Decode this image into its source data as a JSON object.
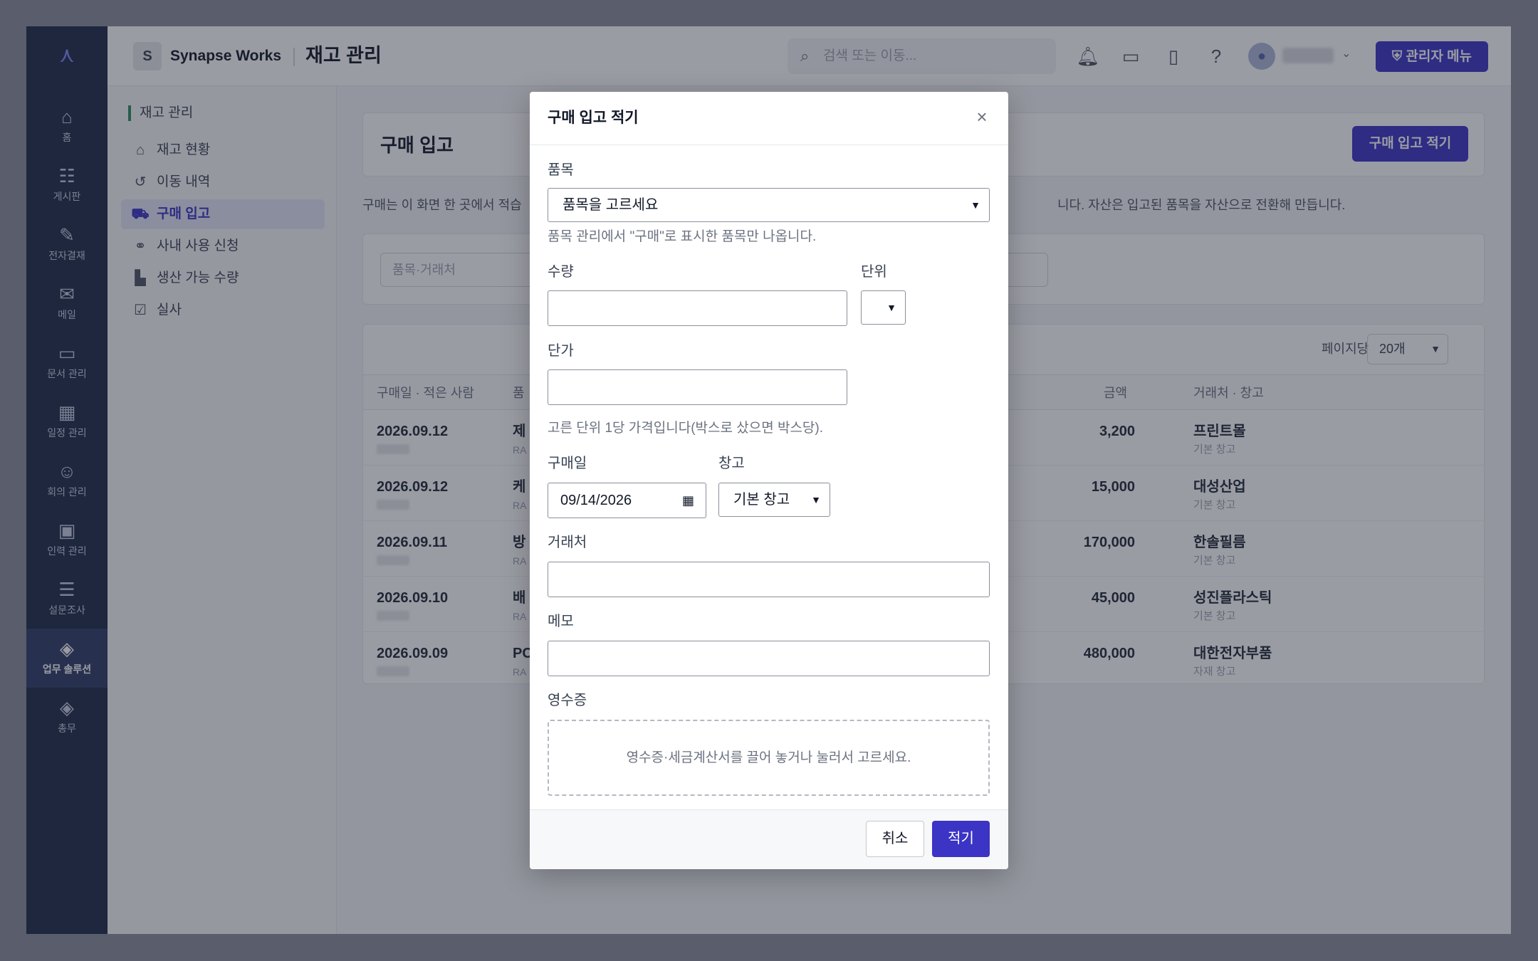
{
  "rail": {
    "logo_icon": "network-logo-icon",
    "items": [
      {
        "label": "홈",
        "icon": "home-icon",
        "glyph": "⌂"
      },
      {
        "label": "게시판",
        "icon": "board-icon",
        "glyph": "☷"
      },
      {
        "label": "전자결재",
        "icon": "approval-icon",
        "glyph": "✎"
      },
      {
        "label": "메일",
        "icon": "mail-icon",
        "glyph": "✉"
      },
      {
        "label": "문서 관리",
        "icon": "folder-icon",
        "glyph": "▭"
      },
      {
        "label": "일정 관리",
        "icon": "calendar-icon",
        "glyph": "▦"
      },
      {
        "label": "회의 관리",
        "icon": "users-icon",
        "glyph": "☺"
      },
      {
        "label": "인력 관리",
        "icon": "badge-icon",
        "glyph": "▣"
      },
      {
        "label": "설문조사",
        "icon": "survey-icon",
        "glyph": "☰"
      },
      {
        "label": "업무 솔루션",
        "icon": "layers-icon",
        "glyph": "◈"
      },
      {
        "label": "총무",
        "icon": "layers-icon",
        "glyph": "◈"
      }
    ]
  },
  "header": {
    "org_initial": "S",
    "org_name": "Synapse Works",
    "page_title": "재고 관리",
    "search_placeholder": "검색 또는 이동...",
    "admin_button": "관리자 메뉴"
  },
  "submenu": {
    "heading": "재고 관리",
    "items": [
      {
        "label": "재고 현황",
        "icon": "warehouse-icon",
        "glyph": "⌂"
      },
      {
        "label": "이동 내역",
        "icon": "history-icon",
        "glyph": "↺"
      },
      {
        "label": "구매 입고",
        "icon": "cart-icon",
        "glyph": "⛟"
      },
      {
        "label": "사내 사용 신청",
        "icon": "handshake-icon",
        "glyph": "⚭"
      },
      {
        "label": "생산 가능 수량",
        "icon": "factory-icon",
        "glyph": "▙"
      },
      {
        "label": "실사",
        "icon": "clipboard-check-icon",
        "glyph": "☑"
      }
    ]
  },
  "main": {
    "title": "구매 입고",
    "new_button": "구매 입고 적기",
    "desc_left": "구매는 이 화면 한 곳에서 적습",
    "desc_right": "니다. 자산은 입고된 품목을 자산으로 전환해 만듭니다.",
    "filter_placeholder": "품목·거래처",
    "perpage_label": "페이지당",
    "perpage_value": "20개",
    "columns": {
      "date": "구매일 · 적은 사람",
      "item": "품",
      "amount": "금액",
      "vendor": "거래처 · 창고"
    },
    "rows": [
      {
        "date": "2026.09.12",
        "item": "제",
        "item_sub": "RA",
        "amount": "3,200",
        "vendor": "프린트몰",
        "warehouse": "기본 창고"
      },
      {
        "date": "2026.09.12",
        "item": "케",
        "item_sub": "RA",
        "amount": "15,000",
        "vendor": "대성산업",
        "warehouse": "기본 창고"
      },
      {
        "date": "2026.09.11",
        "item": "방",
        "item_sub": "RA",
        "amount": "170,000",
        "vendor": "한솔필름",
        "warehouse": "기본 창고"
      },
      {
        "date": "2026.09.10",
        "item": "배",
        "item_sub": "RA",
        "amount": "45,000",
        "vendor": "성진플라스틱",
        "warehouse": "기본 창고"
      },
      {
        "date": "2026.09.09",
        "item": "PC",
        "item_sub": "RA",
        "amount": "480,000",
        "vendor": "대한전자부품",
        "warehouse": "자재 창고"
      }
    ]
  },
  "modal": {
    "title": "구매 입고 적기",
    "item_label": "품목",
    "item_select": "품목을 고르세요",
    "item_help": "품목 관리에서 \"구매\"로 표시한 품목만 나옵니다.",
    "qty_label": "수량",
    "qty_value": "",
    "unit_label": "단위",
    "unit_value": "",
    "price_label": "단가",
    "price_value": "",
    "price_help": "고른 단위 1당 가격입니다(박스로 샀으면 박스당).",
    "date_label": "구매일",
    "date_value": "09/14/2026",
    "warehouse_label": "창고",
    "warehouse_value": "기본 창고",
    "vendor_label": "거래처",
    "vendor_value": "",
    "memo_label": "메모",
    "memo_value": "",
    "receipt_label": "영수증",
    "receipt_drop": "영수증·세금계산서를 끌어 놓거나 눌러서 고르세요.",
    "cancel": "취소",
    "submit": "적기"
  }
}
